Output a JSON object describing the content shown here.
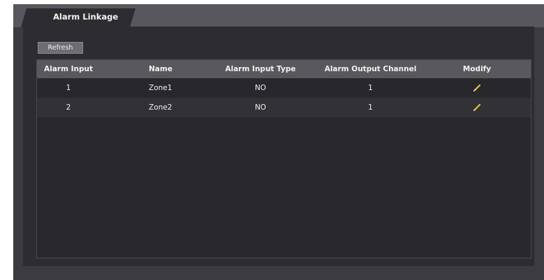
{
  "tab": {
    "label": "Alarm Linkage"
  },
  "toolbar": {
    "refresh_label": "Refresh"
  },
  "table": {
    "columns": [
      "Alarm Input",
      "Name",
      "Alarm Input Type",
      "Alarm Output Channel",
      "Modify"
    ],
    "rows": [
      {
        "alarm_input": "1",
        "name": "Zone1",
        "type": "NO",
        "output_channel": "1",
        "modify_icon": "pencil-icon"
      },
      {
        "alarm_input": "2",
        "name": "Zone2",
        "type": "NO",
        "output_channel": "1",
        "modify_icon": "pencil-icon"
      }
    ]
  },
  "colors": {
    "accent_icon": "#e5c33c",
    "background": "#2d2c31",
    "header": "#59585d"
  }
}
